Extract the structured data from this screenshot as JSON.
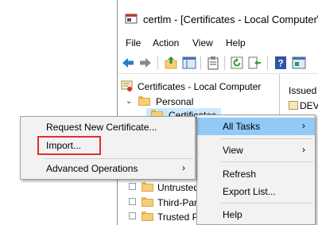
{
  "window": {
    "title": "certlm - [Certificates - Local Computer\\",
    "menu": [
      "File",
      "Action",
      "View",
      "Help"
    ]
  },
  "tree": {
    "root": "Certificates - Local Computer",
    "personal": "Personal",
    "certificates": "Certificates",
    "untrusted": "Untrusted",
    "third_party": "Third-Par",
    "trusted_p": "Trusted P"
  },
  "right_pane": {
    "issued_header": "Issued T",
    "dev_item": "DEV"
  },
  "context_menu": {
    "all_tasks": "All Tasks",
    "view": "View",
    "refresh": "Refresh",
    "export_list": "Export List...",
    "help": "Help"
  },
  "submenu": {
    "request_new": "Request New Certificate...",
    "import": "Import...",
    "advanced": "Advanced Operations"
  },
  "colors": {
    "selection": "#cce8ff",
    "menu_highlight": "#91c9f7",
    "annotation": "#e0302e"
  },
  "icons": [
    "app-icon",
    "back-arrow-icon",
    "forward-arrow-icon",
    "folder-up-icon",
    "show-hide-tree-icon",
    "clipboard-icon",
    "refresh-icon",
    "export-icon",
    "help-icon",
    "properties-icon",
    "folder-icon",
    "certificate-icon",
    "chevron-right-icon",
    "chevron-down-icon"
  ]
}
